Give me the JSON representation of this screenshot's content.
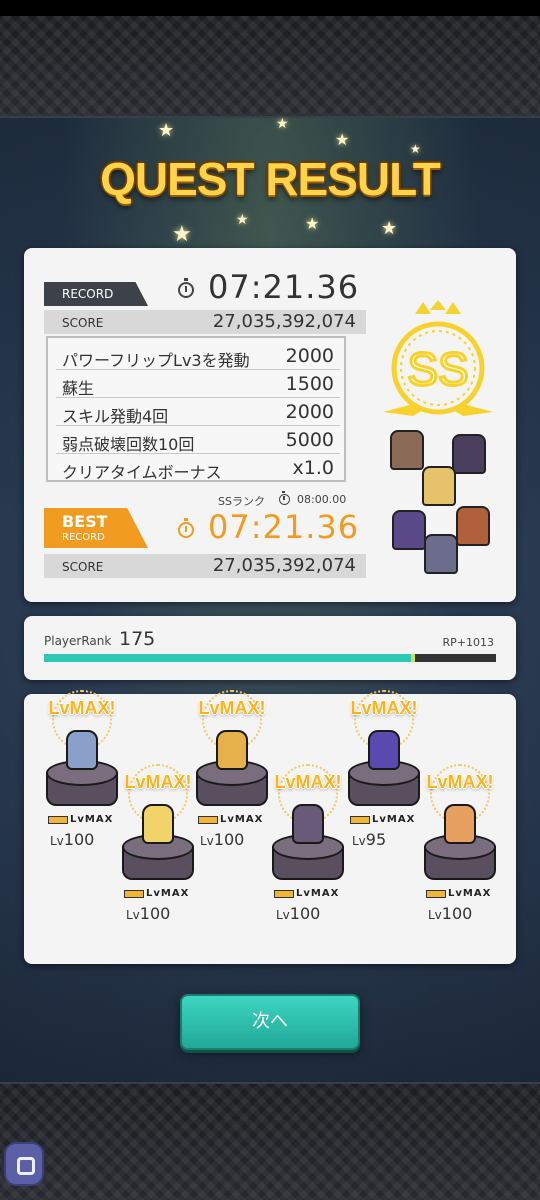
{
  "header": {
    "title": "QUEST RESULT"
  },
  "record": {
    "tag": "RECORD",
    "time": "07:21.36",
    "score_label": "SCORE",
    "score": "27,035,392,074"
  },
  "bonuses": [
    {
      "name": "パワーフリップLv3を発動",
      "value": "2000"
    },
    {
      "name": "蘇生",
      "value": "1500"
    },
    {
      "name": "スキル発動4回",
      "value": "2000"
    },
    {
      "name": "弱点破壊回数10回",
      "value": "5000"
    },
    {
      "name": "クリアタイムボーナス",
      "value": "x1.0"
    }
  ],
  "ss_rank": {
    "label": "SSランク",
    "time": "08:00.00"
  },
  "best_record": {
    "tag_line1": "BEST",
    "tag_line2": "RECORD",
    "time": "07:21.36",
    "score_label": "SCORE",
    "score": "27,035,392,074"
  },
  "rank_badge": "SS",
  "player": {
    "rank_label": "PlayerRank",
    "rank": "175",
    "rp": "RP+1013",
    "progress": 0.82
  },
  "party": [
    {
      "lvmax": "LvMAX!",
      "badge": "LvMAX",
      "lv_prefix": "Lv",
      "level": "100",
      "color": "#8aa0c8"
    },
    {
      "lvmax": "LvMAX!",
      "badge": "LvMAX",
      "lv_prefix": "Lv",
      "level": "100",
      "color": "#f2d36a"
    },
    {
      "lvmax": "LvMAX!",
      "badge": "LvMAX",
      "lv_prefix": "Lv",
      "level": "100",
      "color": "#e6b04a"
    },
    {
      "lvmax": "LvMAX!",
      "badge": "LvMAX",
      "lv_prefix": "Lv",
      "level": "100",
      "color": "#6a5a7a"
    },
    {
      "lvmax": "LvMAX!",
      "badge": "LvMAX",
      "lv_prefix": "Lv",
      "level": "95",
      "color": "#5a4ab0"
    },
    {
      "lvmax": "LvMAX!",
      "badge": "LvMAX",
      "lv_prefix": "Lv",
      "level": "100",
      "color": "#e8a060"
    }
  ],
  "next_button": "次へ",
  "colors": {
    "accent_teal": "#2cc9b5",
    "accent_orange": "#f29b21",
    "gold": "#ffd34a"
  }
}
